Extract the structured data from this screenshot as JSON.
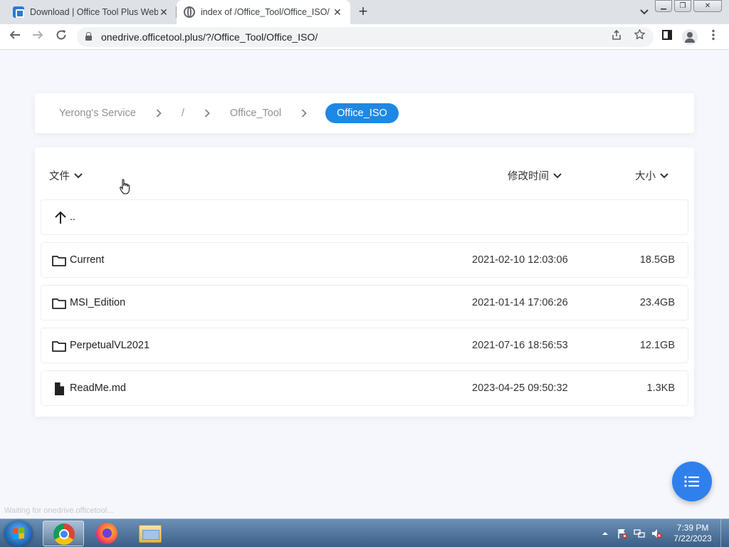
{
  "browser": {
    "tabs": [
      {
        "title": "Download | Office Tool Plus Web",
        "favicon": "office-tool-plus-icon"
      },
      {
        "title": "index of /Office_Tool/Office_ISO/",
        "favicon": "globe-icon"
      }
    ],
    "url": "onedrive.officetool.plus/?/Office_Tool/Office_ISO/",
    "status": "Waiting for onedrive.officetool..."
  },
  "breadcrumb": {
    "items": [
      "Yerong's Service",
      "/",
      "Office_Tool",
      "Office_ISO"
    ]
  },
  "list": {
    "headers": {
      "name": "文件",
      "modified": "修改时间",
      "size": "大小"
    },
    "parent": "..",
    "rows": [
      {
        "type": "folder",
        "name": "Current",
        "modified": "2021-02-10 12:03:06",
        "size": "18.5GB"
      },
      {
        "type": "folder",
        "name": "MSI_Edition",
        "modified": "2021-01-14 17:06:26",
        "size": "23.4GB"
      },
      {
        "type": "folder",
        "name": "PerpetualVL2021",
        "modified": "2021-07-16 18:56:53",
        "size": "12.1GB"
      },
      {
        "type": "file",
        "name": "ReadMe.md",
        "modified": "2023-04-25 09:50:32",
        "size": "1.3KB"
      }
    ]
  },
  "taskbar": {
    "time": "7:39 PM",
    "date": "7/22/2023",
    "apps": [
      "chrome-icon",
      "firefox-icon",
      "file-explorer-icon"
    ]
  },
  "colors": {
    "accent": "#1e88e5",
    "fab": "#2f80ed",
    "background": "#f5f7fc"
  }
}
